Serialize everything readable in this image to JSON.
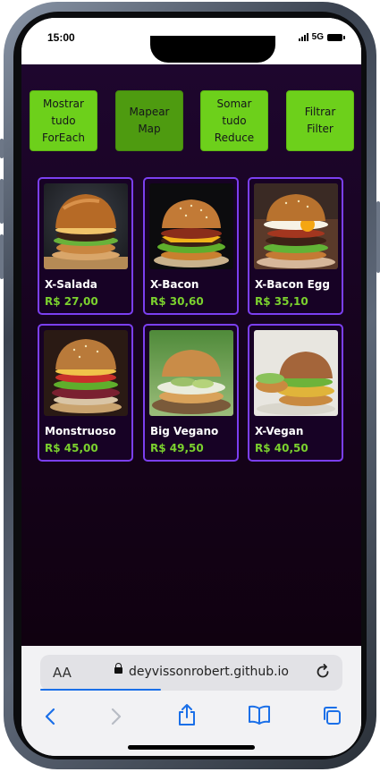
{
  "status": {
    "time": "15:00",
    "network": "5G"
  },
  "actions": [
    {
      "label": "Mostrar\ntudo\nForEach",
      "active": false
    },
    {
      "label": "Mapear\nMap",
      "active": true
    },
    {
      "label": "Somar\ntudo\nReduce",
      "active": false
    },
    {
      "label": "Filtrar\nFilter",
      "active": false
    }
  ],
  "products": [
    {
      "name": "X-Salada",
      "price": "R$ 27,00",
      "image_icon": "burger-salad-photo"
    },
    {
      "name": "X-Bacon",
      "price": "R$ 30,60",
      "image_icon": "burger-bacon-photo"
    },
    {
      "name": "X-Bacon Egg",
      "price": "R$ 35,10",
      "image_icon": "burger-bacon-egg-photo"
    },
    {
      "name": "Monstruoso",
      "price": "R$ 45,00",
      "image_icon": "burger-monstruoso-photo"
    },
    {
      "name": "Big Vegano",
      "price": "R$ 49,50",
      "image_icon": "burger-vegan-photo"
    },
    {
      "name": "X-Vegan",
      "price": "R$ 40,50",
      "image_icon": "burger-xvegan-photo"
    }
  ],
  "browser": {
    "text_size_label": "AA",
    "url": "deyvissonrobert.github.io"
  },
  "colors": {
    "button_green": "#6dd01b",
    "button_green_active": "#4e9b10",
    "card_border": "#7b3ff0",
    "price_green": "#7bd12e",
    "background": "#1e062e",
    "progress_blue": "#1a6fe8"
  }
}
